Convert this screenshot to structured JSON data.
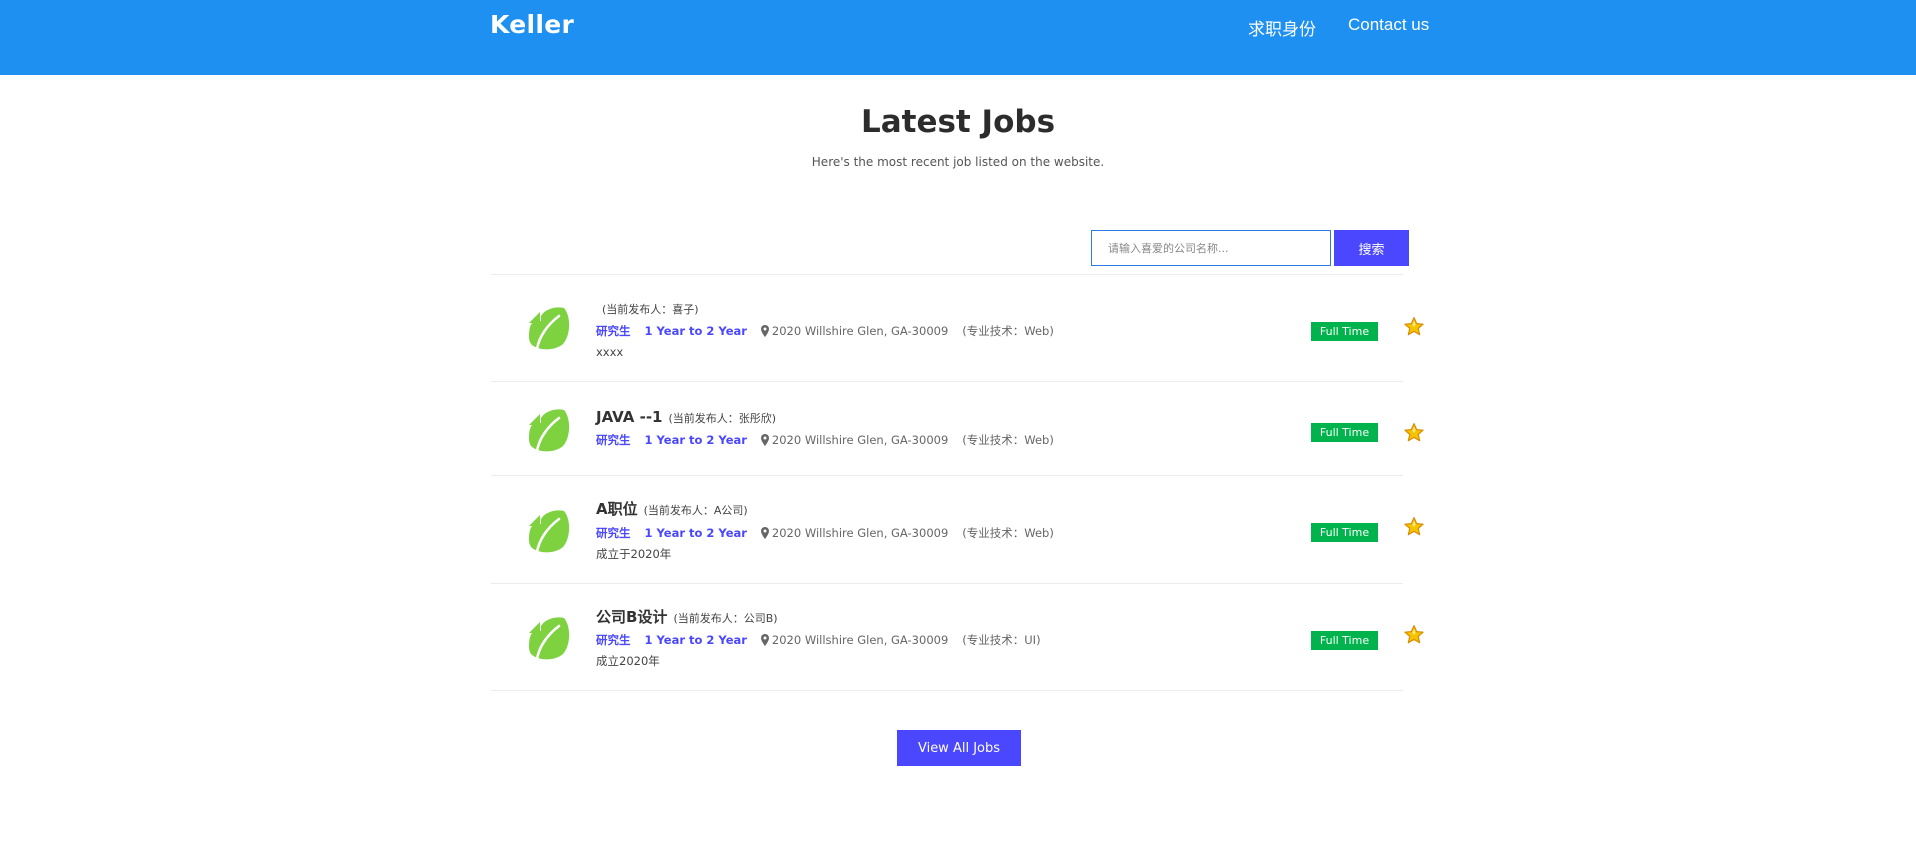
{
  "header": {
    "brand": "Keller",
    "nav": [
      "求职身份",
      "Contact us"
    ],
    "background_color": "#1e90f1"
  },
  "section": {
    "title": "Latest Jobs",
    "subtitle": "Here's the most recent job listed on the website."
  },
  "search": {
    "placeholder": "请输入喜爱的公司名称...",
    "value": "",
    "button_label": "搜索"
  },
  "jobs": [
    {
      "title": "",
      "poster": "(当前发布人：喜子)",
      "education": "研究生",
      "experience": "1 Year to 2 Year",
      "location": "2020 Willshire Glen, GA-30009",
      "tech": "(专业技术：Web)",
      "description": "xxxx",
      "type": "Full Time",
      "logo_icon": "evernote-leaf-icon",
      "favorite_icon": "star-icon"
    },
    {
      "title": "JAVA --1",
      "poster": "(当前发布人：张彤欣)",
      "education": "研究生",
      "experience": "1 Year to 2 Year",
      "location": "2020 Willshire Glen, GA-30009",
      "tech": "(专业技术：Web)",
      "description": "",
      "type": "Full Time",
      "logo_icon": "evernote-leaf-icon",
      "favorite_icon": "star-icon"
    },
    {
      "title": "A职位",
      "poster": "(当前发布人：A公司)",
      "education": "研究生",
      "experience": "1 Year to 2 Year",
      "location": "2020 Willshire Glen, GA-30009",
      "tech": "(专业技术：Web)",
      "description": "成立于2020年",
      "type": "Full Time",
      "logo_icon": "evernote-leaf-icon",
      "favorite_icon": "star-icon"
    },
    {
      "title": "公司B设计",
      "poster": "(当前发布人：公司B)",
      "education": "研究生",
      "experience": "1 Year to 2 Year",
      "location": "2020 Willshire Glen, GA-30009",
      "tech": "(专业技术：UI)",
      "description": "成立2020年",
      "type": "Full Time",
      "logo_icon": "evernote-leaf-icon",
      "favorite_icon": "star-icon"
    }
  ],
  "view_all_label": "View All Jobs",
  "colors": {
    "accent": "#4a47ff",
    "badge": "#00b34c",
    "logo": "#7ed13f",
    "star": "#f5c400"
  }
}
